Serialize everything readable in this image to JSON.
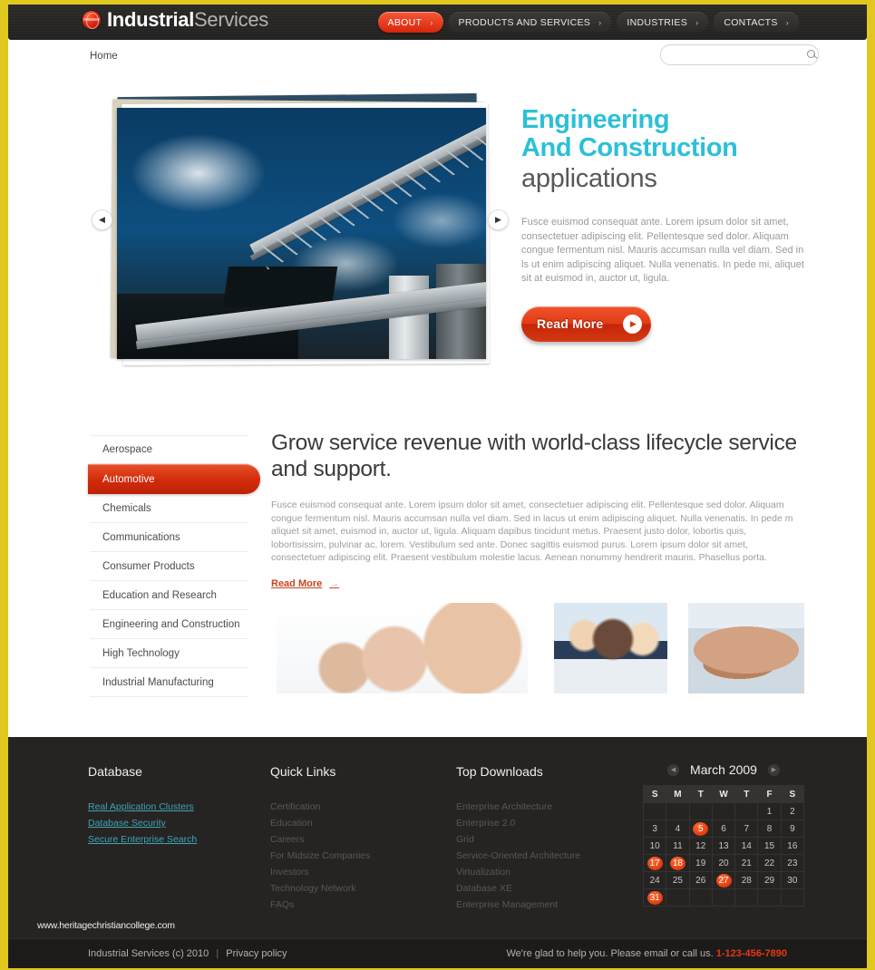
{
  "header": {
    "logo": {
      "bold": "Industrial",
      "light": "Services",
      "icon": "globe-icon"
    },
    "nav": [
      {
        "label": "ABOUT",
        "active": true
      },
      {
        "label": "PRODUCTS AND SERVICES",
        "active": false
      },
      {
        "label": "INDUSTRIES",
        "active": false
      },
      {
        "label": "CONTACTS",
        "active": false
      }
    ],
    "chevron": "›"
  },
  "topbar": {
    "breadcrumb": "Home",
    "search": {
      "value": "",
      "placeholder": "",
      "icon": "search-icon"
    }
  },
  "slider": {
    "heading_line1": "Engineering",
    "heading_line2": "And Construction",
    "subheading": "applications",
    "paragraph": "Fusce euismod consequat ante. Lorem ipsum dolor sit amet, consectetuer adipiscing elit. Pellentesque sed dolor. Aliquam congue fermentum nisl. Mauris accumsan nulla vel diam. Sed in ls ut enim adipiscing aliquet. Nulla venenatis. In pede mi, aliquet sit at euismod in, auctor ut, ligula.",
    "button_label": "Read More",
    "prev_icon": "◀",
    "next_icon": "▶",
    "image_alt": "industrial-conveyor-plant-photo",
    "accent_color": "#2cc0d8"
  },
  "content": {
    "sidebar_items": [
      {
        "label": "Aerospace",
        "active": false
      },
      {
        "label": "Automotive",
        "active": true
      },
      {
        "label": "Chemicals",
        "active": false
      },
      {
        "label": "Communications",
        "active": false
      },
      {
        "label": "Consumer Products",
        "active": false
      },
      {
        "label": "Education and Research",
        "active": false
      },
      {
        "label": "Engineering and Construction",
        "active": false
      },
      {
        "label": "High Technology",
        "active": false
      },
      {
        "label": "Industrial Manufacturing",
        "active": false
      }
    ],
    "heading": "Grow service revenue with world-class lifecycle service and support.",
    "paragraph": "Fusce euismod consequat ante. Lorem ipsum dolor sit amet, consectetuer adipiscing elit. Pellentesque sed dolor. Aliquam congue fermentum nisl. Mauris accumsan nulla vel diam. Sed in lacus ut enim adipiscing aliquet. Nulla venenatis. In pede m aliquet sit amet, euismod in, auctor ut, ligula. Aliquam dapibus tincidunt metus. Praesent justo dolor, lobortis quis, lobortisissim, pulvinar ac, lorem. Vestibulum sed ante. Donec sagittis euismod purus. Lorem ipsum dolor sit amet, consectetuer adipiscing elit. Praesent vestibulum molestie lacus. Aenean nonummy hendrerit mauris. Phasellus porta.",
    "read_more": "Read More",
    "read_more_arrow": "→",
    "thumbnails": [
      {
        "alt": "group-of-people-photo"
      },
      {
        "alt": "business-team-photo"
      },
      {
        "alt": "hands-together-photo"
      }
    ]
  },
  "footer": {
    "columns": [
      {
        "title": "Database",
        "style": "teal",
        "links": [
          "Real Application Clusters",
          "Database Security",
          "Secure Enterprise Search"
        ]
      },
      {
        "title": "Quick Links",
        "style": "dim",
        "links": [
          "Certification",
          "Education",
          "Careers",
          "For Midsize Companies",
          "Investors",
          "Technology Network",
          "FAQs"
        ]
      },
      {
        "title": "Top Downloads",
        "style": "dim",
        "links": [
          "Enterprise Architecture",
          "Enterprise 2.0",
          "Grid",
          "Service-Oriented Architecture",
          "Virtualization",
          "Database XE",
          "Enterprise Management"
        ]
      }
    ],
    "calendar": {
      "title": "March 2009",
      "prev_icon": "◀",
      "next_icon": "▶",
      "weekdays": [
        "S",
        "M",
        "T",
        "W",
        "T",
        "F",
        "S"
      ],
      "weeks": [
        [
          "",
          "",
          "",
          "",
          "",
          "1",
          "2"
        ],
        [
          "3",
          "4",
          "5",
          "6",
          "7",
          "8",
          "9"
        ],
        [
          "10",
          "11",
          "12",
          "13",
          "14",
          "15",
          "16"
        ],
        [
          "17",
          "18",
          "19",
          "20",
          "21",
          "22",
          "23"
        ],
        [
          "24",
          "25",
          "26",
          "27",
          "28",
          "29",
          "30"
        ],
        [
          "31",
          "",
          "",
          "",
          "",
          "",
          ""
        ]
      ],
      "highlighted": [
        "5",
        "17",
        "18",
        "27",
        "31"
      ],
      "highlight_color": "#e23a0c"
    }
  },
  "watermark": "www.heritagechristiancollege.com",
  "bottombar": {
    "copyright": "Industrial Services (c) 2010",
    "separator": "|",
    "privacy": "Privacy policy",
    "help_text": "We're glad to help you. Please email or call us.",
    "phone": "1-123-456-7890"
  }
}
